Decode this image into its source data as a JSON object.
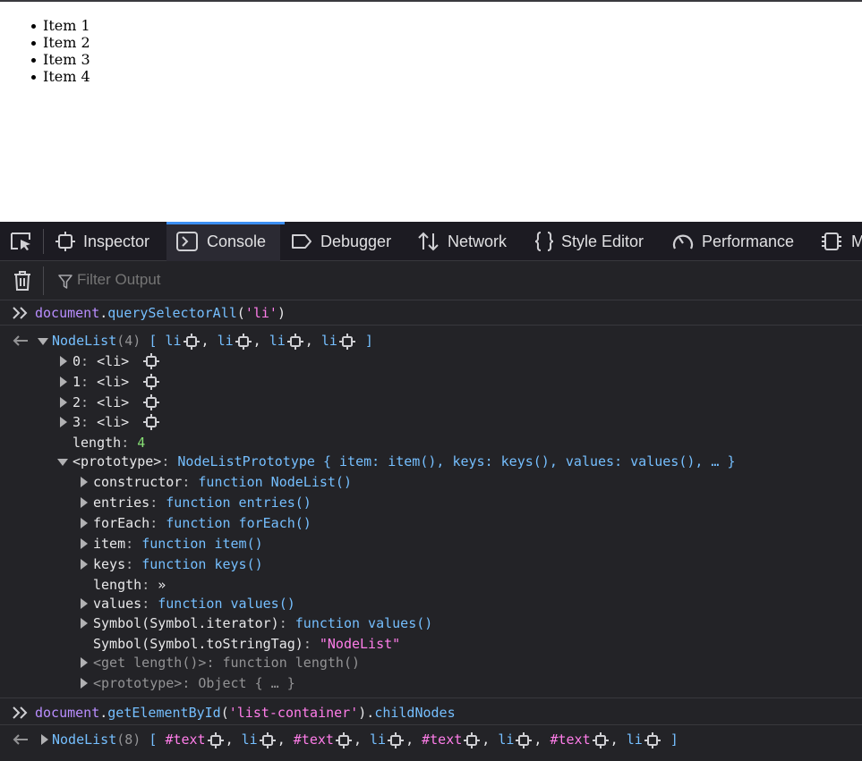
{
  "page": {
    "list_items": [
      "Item 1",
      "Item 2",
      "Item 3",
      "Item 4"
    ]
  },
  "tabs": {
    "picker_icon": "element-picker-icon",
    "items": [
      {
        "label": "Inspector",
        "icon": "inspector-icon"
      },
      {
        "label": "Console",
        "icon": "console-icon",
        "active": true
      },
      {
        "label": "Debugger",
        "icon": "debugger-icon"
      },
      {
        "label": "Network",
        "icon": "network-icon"
      },
      {
        "label": "Style Editor",
        "icon": "style-editor-icon"
      },
      {
        "label": "Performance",
        "icon": "performance-icon"
      },
      {
        "label": "M",
        "icon": "memory-icon"
      }
    ]
  },
  "toolbar": {
    "clear_icon": "trash-icon",
    "filter_icon": "filter-icon",
    "filter_placeholder": "Filter Output"
  },
  "colors": {
    "accent": "#3b8ff3",
    "object": "#75bfff",
    "number": "#86de74",
    "string": "#ff7de9",
    "keyword": "#b98eff"
  },
  "console": {
    "input1": {
      "obj": "document",
      "dot": ".",
      "method": "querySelectorAll",
      "open": "(",
      "arg": "'li'",
      "close": ")"
    },
    "result1": {
      "type": "NodeList",
      "count": "(4)",
      "open_bracket": "[",
      "close_bracket": "]",
      "preview": [
        "li",
        "li",
        "li",
        "li"
      ],
      "comma": ",",
      "entries": [
        {
          "index": "0",
          "value": "<li>"
        },
        {
          "index": "1",
          "value": "<li>"
        },
        {
          "index": "2",
          "value": "<li>"
        },
        {
          "index": "3",
          "value": "<li>"
        }
      ],
      "colon": ":",
      "length_key": "length",
      "length_value": "4",
      "proto_key": "<prototype>",
      "proto_value": "NodeListPrototype { item: item(), keys: keys(), values: values(), … }",
      "proto_entries": [
        {
          "key": "constructor",
          "value": "function NodeList()",
          "expandable": true
        },
        {
          "key": "entries",
          "value": "function entries()",
          "expandable": true
        },
        {
          "key": "forEach",
          "value": "function forEach()",
          "expandable": true
        },
        {
          "key": "item",
          "value": "function item()",
          "expandable": true
        },
        {
          "key": "keys",
          "value": "function keys()",
          "expandable": true
        },
        {
          "key": "length",
          "value": "»",
          "expandable": false
        },
        {
          "key": "values",
          "value": "function values()",
          "expandable": true
        },
        {
          "key": "Symbol(Symbol.iterator)",
          "value": "function values()",
          "expandable": true
        },
        {
          "key": "Symbol(Symbol.toStringTag)",
          "value": "\"NodeList\"",
          "expandable": false
        }
      ],
      "getter": {
        "key": "<get length()>",
        "value": "function length()"
      },
      "proto2": {
        "key": "<prototype>",
        "value": "Object { … }"
      }
    },
    "input2": {
      "obj": "document",
      "dot": ".",
      "method": "getElementById",
      "open": "(",
      "arg": "'list-container'",
      "close": ")",
      "dot2": ".",
      "prop": "childNodes"
    },
    "result2": {
      "type": "NodeList",
      "count": "(8)",
      "open_bracket": "[",
      "close_bracket": "]",
      "preview": [
        "#text",
        "li",
        "#text",
        "li",
        "#text",
        "li",
        "#text",
        "li"
      ]
    }
  }
}
